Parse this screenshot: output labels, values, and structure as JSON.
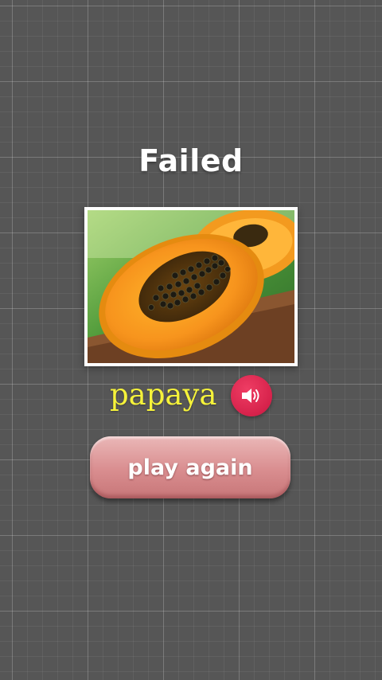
{
  "result": {
    "title": "Failed"
  },
  "card": {
    "image_subject": "papaya halves with black seeds",
    "word": "papaya",
    "speaker_icon": "speaker-icon"
  },
  "actions": {
    "play_again_label": "play again"
  },
  "colors": {
    "background": "#565656",
    "word": "#f5f23a",
    "speaker_button": "#d6224b",
    "play_button": "#d98d8f"
  }
}
